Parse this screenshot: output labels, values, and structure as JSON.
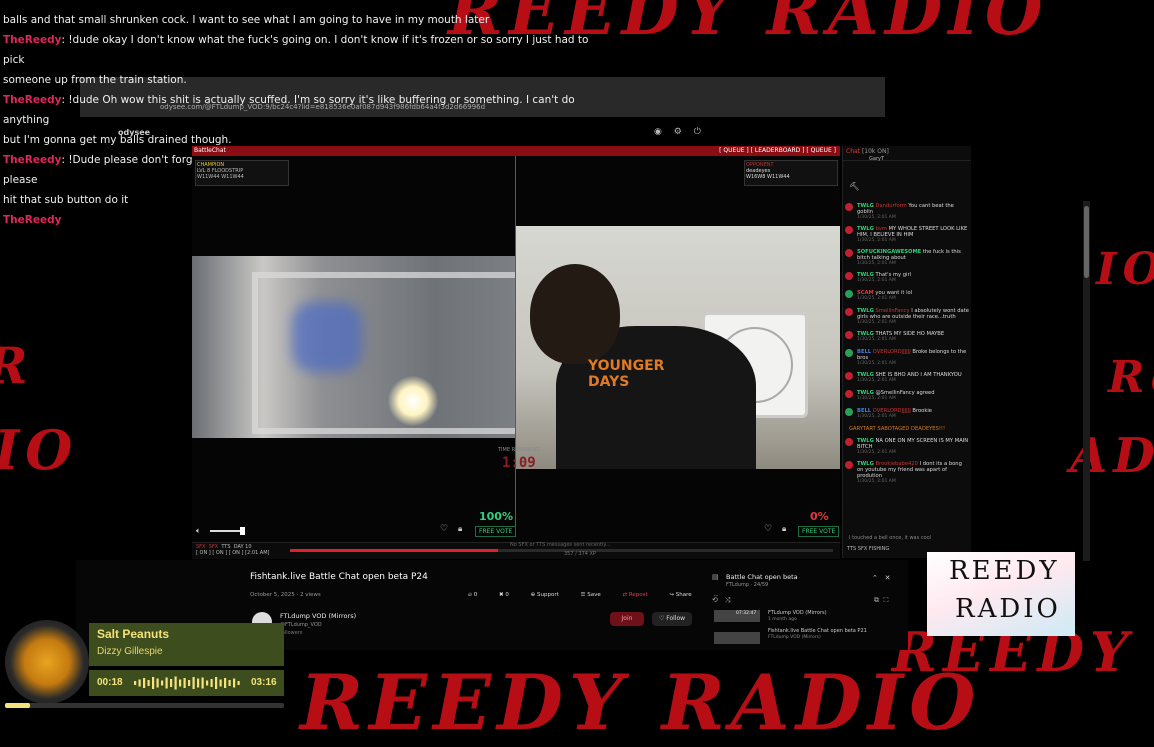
{
  "background_text": {
    "brand": "REEDY RADIO",
    "brand_vertical": "RADIO"
  },
  "overlay_chat": [
    {
      "user": "",
      "text": "balls and that small shrunken cock. I want to see what I am going to have in my mouth later"
    },
    {
      "user": "TheReedy",
      "text": ": !dude okay I don't know what the fuck's going on. I don't know if it's frozen or so sorry I just had to pick"
    },
    {
      "user": "",
      "text": "someone up from the train station."
    },
    {
      "user": "TheReedy",
      "text": ": !dude Oh wow this shit is actually scuffed. I'm so sorry it's like buffering or something. I can't do anything"
    },
    {
      "user": "",
      "text": "but I'm gonna get my balls drained though."
    },
    {
      "user": "TheReedy",
      "text": ": !Dude please don't forget to subscribe to Reed radio so he can get better Internet please oh my god please"
    },
    {
      "user": "",
      "text": "hit that sub button do it"
    },
    {
      "user": "TheReedy",
      "text": ""
    }
  ],
  "browser": {
    "url": "odysee.com/@FTLdump_VOD:9/bc24c4?lid=e818536e0af087d943f986fdb64a4f3d2d66996d",
    "logo": "odysee"
  },
  "app": {
    "title": "BattleChat",
    "menu": "[ QUEUE ] [ LEADERBOARD ] [ QUEUE ]",
    "player1": {
      "rank": "CHAMPION",
      "level": "LVL 8",
      "tag": "FLOODSTRIP",
      "stats": "W11W44 W11W44"
    },
    "player2": {
      "label": "OPPONENT",
      "name": "deadeyes",
      "stats": "W16W8 W11W44"
    },
    "timer_label": "TIME REMAINING",
    "timer": "1:09",
    "pct_left": "100%",
    "pct_right": "0%",
    "vote_label": "FREE VOTE",
    "status_labels": [
      "SFX",
      "SFX",
      "TTS",
      "DAY 10"
    ],
    "status_sub": "[ ON ] [ ON ] [ ON ] [2:01 AM]",
    "status_note": "No SFX or TTS messages sent recently...",
    "status_count": "357 / 374 XP"
  },
  "chat": {
    "header": "Chat",
    "header_right": "[10k ON]",
    "top_badge": "GaryT",
    "messages": [
      {
        "tag": "TWLG",
        "tag_class": "",
        "user": "Dandurform",
        "text": "You cant beat the goblin",
        "time": "1/30/25, 2:01 AM"
      },
      {
        "tag": "TWLG",
        "tag_class": "",
        "user": "bvm",
        "text": "MY WHOLE STREET LOOK LIKE HIM, I BELIEVE IN HIM",
        "time": "1/30/25, 2:01 AM"
      },
      {
        "tag": "SOFUCKINGAWESOME",
        "tag_class": "",
        "user": "",
        "text": "the fuck is this bitch talking about",
        "time": "1/30/25, 2:01 AM"
      },
      {
        "tag": "TWLG",
        "tag_class": "",
        "user": "",
        "text": "That's my girl",
        "time": "1/30/25, 2:01 AM"
      },
      {
        "tag": "SCAM",
        "tag_class": "r",
        "user": "",
        "text": "you want it lol",
        "time": "1/30/25, 2:01 AM"
      },
      {
        "tag": "TWLG",
        "tag_class": "",
        "user": "SmellinFancy",
        "text": "I absolutely wont date girls who are outside their race...truth",
        "time": "1/30/25, 2:01 AM"
      },
      {
        "tag": "TWLG",
        "tag_class": "",
        "user": "",
        "text": "THATS MY SIDE HO MAYBE",
        "time": "1/30/25, 2:01 AM"
      },
      {
        "tag": "BELL",
        "tag_class": "b",
        "user": "OVERLORDJJJJJJ",
        "text": "Broke belongs to the bros",
        "time": "1/30/25, 2:01 AM"
      },
      {
        "tag": "TWLG",
        "tag_class": "",
        "user": "",
        "text": "SHE IS BHO AND I AM THANKYOU",
        "time": "1/30/25, 2:01 AM"
      },
      {
        "tag": "TWLG",
        "tag_class": "",
        "user": "",
        "text": "@SmellinFancy agreed",
        "time": "1/30/25, 2:01 AM"
      },
      {
        "tag": "BELL",
        "tag_class": "b",
        "user": "OVERLORDJJJJJJ",
        "text": "Brookie",
        "time": "1/30/25, 2:01 AM"
      },
      {
        "tag": "",
        "tag_class": "",
        "user": "",
        "text": "GARYTART SABOTAGED DEADEYES!!!",
        "time": "",
        "system": true
      },
      {
        "tag": "TWLG",
        "tag_class": "",
        "user": "",
        "text": "NA ONE ON MY SCREEN IS MY MAIN BITCH",
        "time": "1/30/25, 2:01 AM"
      },
      {
        "tag": "TWLG",
        "tag_class": "",
        "user": "Brookiebabe420",
        "text": "I dont its a bong on youtube my friend was apart of prodution",
        "time": "1/30/25, 2:01 AM"
      }
    ],
    "input_note": "I touched a bell once, it was cool",
    "footer": "TTS   SFX   FISHING"
  },
  "youtube": {
    "title": "Fishtank.live Battle Chat open beta P24",
    "date": "October 5, 2025  ·  2 views",
    "actions": [
      "0",
      "0",
      "Support",
      "Save",
      "Repost",
      "Share",
      "..."
    ],
    "channel": "FTLdump VOD (Mirrors)",
    "handle": "@FTLdump_VOD",
    "subs": "followers",
    "join": "Join",
    "follow": "Follow",
    "playlist_title": "Battle Chat open beta",
    "playlist_sub": "FTLdump · 24/59",
    "playlist_item1_channel": "FTLdump VOD (Mirrors)",
    "playlist_item1_age": "1 month ago",
    "playlist_item1_ts": "07:32:47",
    "playlist_item2_title": "Fishtank.live Battle Chat open beta P21",
    "playlist_item2_channel": "FTLdump VOD (Mirrors)"
  },
  "logo": {
    "line1": "REEDY",
    "line2": "RADIO"
  },
  "now_playing": {
    "title": "Salt Peanuts",
    "artist": "Dizzy Gillespie",
    "current": "00:18",
    "duration": "03:16",
    "progress": 0.09
  },
  "colors": {
    "brand_red": "#d1101a",
    "player_accent": "#f3e37a",
    "player_bg": "#3e4d1e",
    "vote_green": "#2fd17c"
  }
}
